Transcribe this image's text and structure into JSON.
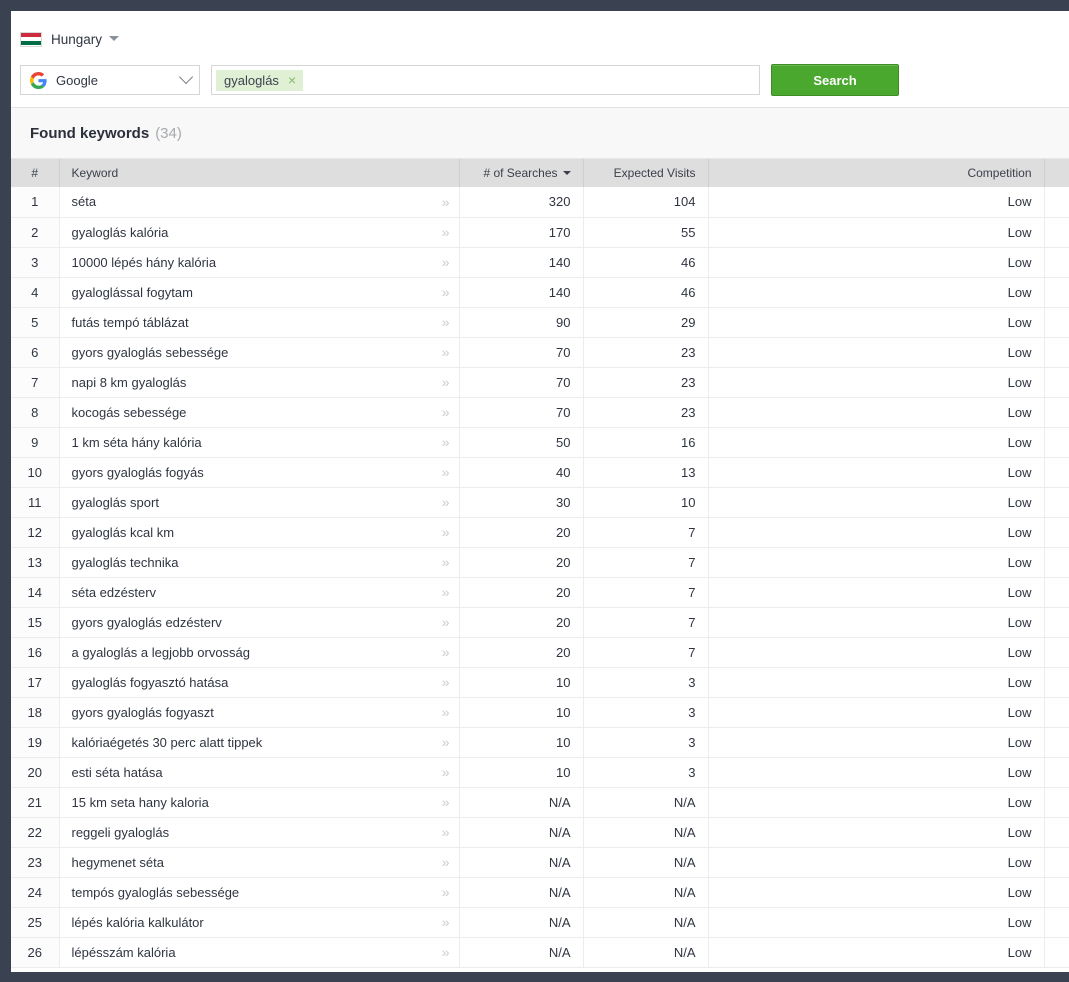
{
  "country": {
    "name": "Hungary",
    "flag_colors": [
      "#cd2a3e",
      "#ffffff",
      "#006e45"
    ],
    "chevron_icon": "chevron-down-icon"
  },
  "search_panel": {
    "engine": {
      "label": "Google",
      "icon": "google-logo-icon"
    },
    "keyword_tag": {
      "text": "gyaloglás",
      "remove_icon": "×"
    },
    "input_placeholder": "",
    "search_button_label": "Search",
    "accent_color": "#4ba82e",
    "tag_background": "#dff0d4"
  },
  "results": {
    "title": "Found keywords",
    "count": "(34)",
    "columns": {
      "num": "#",
      "keyword": "Keyword",
      "searches": "# of Searches",
      "visits": "Expected Visits",
      "competition": "Competition",
      "extra": ""
    },
    "sorted_by": "# of Searches",
    "sort_direction": "desc",
    "expand_icon": "»",
    "rows": [
      {
        "num": "1",
        "keyword": "séta",
        "searches": "320",
        "visits": "104",
        "competition": "Low"
      },
      {
        "num": "2",
        "keyword": "gyaloglás kalória",
        "searches": "170",
        "visits": "55",
        "competition": "Low"
      },
      {
        "num": "3",
        "keyword": "10000 lépés hány kalória",
        "searches": "140",
        "visits": "46",
        "competition": "Low"
      },
      {
        "num": "4",
        "keyword": "gyaloglással fogytam",
        "searches": "140",
        "visits": "46",
        "competition": "Low"
      },
      {
        "num": "5",
        "keyword": "futás tempó táblázat",
        "searches": "90",
        "visits": "29",
        "competition": "Low"
      },
      {
        "num": "6",
        "keyword": "gyors gyaloglás sebessége",
        "searches": "70",
        "visits": "23",
        "competition": "Low"
      },
      {
        "num": "7",
        "keyword": "napi 8 km gyaloglás",
        "searches": "70",
        "visits": "23",
        "competition": "Low"
      },
      {
        "num": "8",
        "keyword": "kocogás sebessége",
        "searches": "70",
        "visits": "23",
        "competition": "Low"
      },
      {
        "num": "9",
        "keyword": "1 km séta hány kalória",
        "searches": "50",
        "visits": "16",
        "competition": "Low"
      },
      {
        "num": "10",
        "keyword": "gyors gyaloglás fogyás",
        "searches": "40",
        "visits": "13",
        "competition": "Low"
      },
      {
        "num": "11",
        "keyword": "gyaloglás sport",
        "searches": "30",
        "visits": "10",
        "competition": "Low"
      },
      {
        "num": "12",
        "keyword": "gyaloglás kcal km",
        "searches": "20",
        "visits": "7",
        "competition": "Low"
      },
      {
        "num": "13",
        "keyword": "gyaloglás technika",
        "searches": "20",
        "visits": "7",
        "competition": "Low"
      },
      {
        "num": "14",
        "keyword": "séta edzésterv",
        "searches": "20",
        "visits": "7",
        "competition": "Low"
      },
      {
        "num": "15",
        "keyword": "gyors gyaloglás edzésterv",
        "searches": "20",
        "visits": "7",
        "competition": "Low"
      },
      {
        "num": "16",
        "keyword": "a gyaloglás a legjobb orvosság",
        "searches": "20",
        "visits": "7",
        "competition": "Low"
      },
      {
        "num": "17",
        "keyword": "gyaloglás fogyasztó hatása",
        "searches": "10",
        "visits": "3",
        "competition": "Low"
      },
      {
        "num": "18",
        "keyword": "gyors gyaloglás fogyaszt",
        "searches": "10",
        "visits": "3",
        "competition": "Low"
      },
      {
        "num": "19",
        "keyword": "kalóriaégetés 30 perc alatt tippek",
        "searches": "10",
        "visits": "3",
        "competition": "Low"
      },
      {
        "num": "20",
        "keyword": "esti séta hatása",
        "searches": "10",
        "visits": "3",
        "competition": "Low"
      },
      {
        "num": "21",
        "keyword": "15 km seta hany kaloria",
        "searches": "N/A",
        "visits": "N/A",
        "competition": "Low"
      },
      {
        "num": "22",
        "keyword": "reggeli gyaloglás",
        "searches": "N/A",
        "visits": "N/A",
        "competition": "Low"
      },
      {
        "num": "23",
        "keyword": "hegymenet séta",
        "searches": "N/A",
        "visits": "N/A",
        "competition": "Low"
      },
      {
        "num": "24",
        "keyword": "tempós gyaloglás sebessége",
        "searches": "N/A",
        "visits": "N/A",
        "competition": "Low"
      },
      {
        "num": "25",
        "keyword": "lépés kalória kalkulátor",
        "searches": "N/A",
        "visits": "N/A",
        "competition": "Low"
      },
      {
        "num": "26",
        "keyword": "lépésszám kalória",
        "searches": "N/A",
        "visits": "N/A",
        "competition": "Low"
      }
    ]
  }
}
